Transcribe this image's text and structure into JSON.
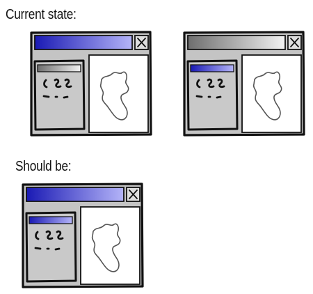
{
  "captions": {
    "current_state": "Current state:",
    "should_be": "Should be:"
  },
  "windows": [
    {
      "id": "current-left",
      "titlebar_state": "active",
      "inner_panel_titlebar_state": "inactive"
    },
    {
      "id": "current-right",
      "titlebar_state": "inactive",
      "inner_panel_titlebar_state": "active"
    },
    {
      "id": "should-be",
      "titlebar_state": "active",
      "inner_panel_titlebar_state": "active"
    }
  ],
  "icons": {
    "close": "close-x-icon",
    "map_outline": "map-outline-icon",
    "scribble_text": "scribble-text-icon"
  },
  "colors": {
    "active_titlebar_left": "#1a1ab4",
    "active_titlebar_right": "#b4b4f8",
    "inactive_titlebar_left": "#6e6e6e",
    "inactive_titlebar_right": "#f2f2f2",
    "frame_gray": "#c4c4c4",
    "inner_panel_gray": "#c9c9c9",
    "outline": "#111111"
  }
}
